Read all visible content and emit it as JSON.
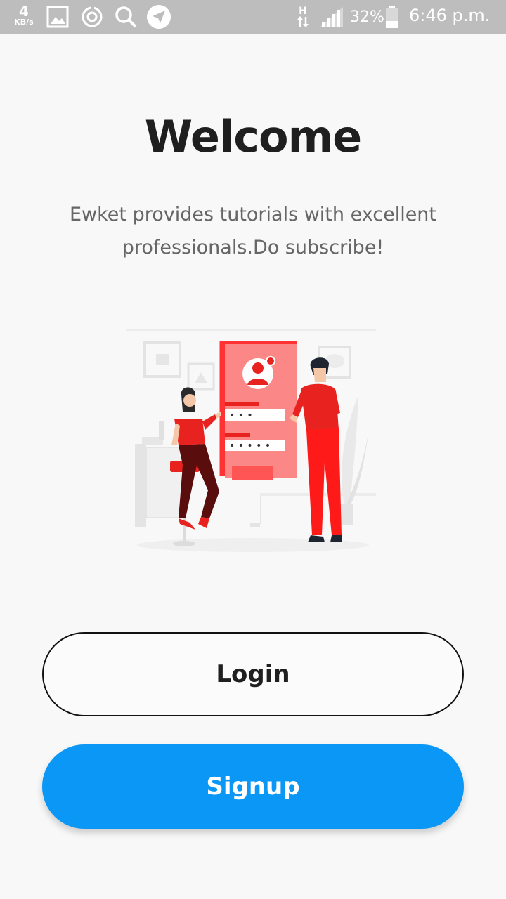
{
  "status_bar": {
    "speed_value": "4",
    "speed_unit": "KB/s",
    "network_type": "H",
    "battery": "32%",
    "time": "6:46 p.m.",
    "icons": [
      "image-icon",
      "sync-icon",
      "search-icon",
      "send-icon",
      "data-arrows-icon",
      "signal-icon",
      "battery-icon"
    ]
  },
  "welcome": {
    "title": "Welcome",
    "subtitle_line1": "Ewket provides tutorials with excellent",
    "subtitle_line2": "professionals.Do subscribe!"
  },
  "illustration": {
    "password_mask_1": "• • •",
    "password_mask_2": "• • • • •"
  },
  "actions": {
    "login_label": "Login",
    "signup_label": "Signup"
  },
  "colors": {
    "accent_blue": "#0a97f5",
    "illustration_red": "#e8231f",
    "status_bar_gray": "#bdbdbd"
  }
}
